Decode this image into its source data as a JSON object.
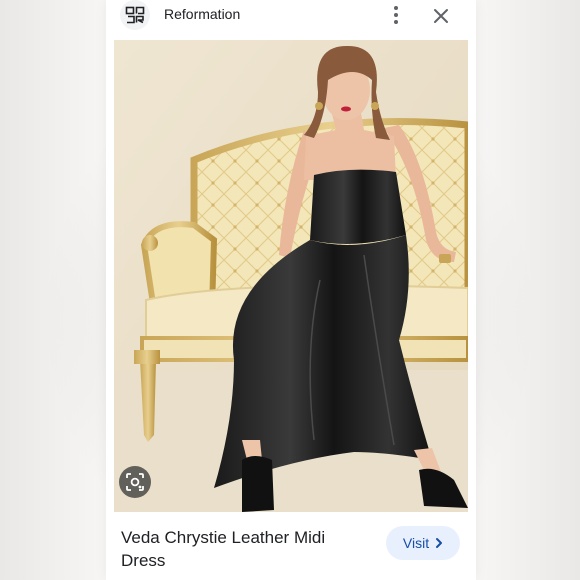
{
  "header": {
    "site_name": "Reformation",
    "logo_icon": "reformation-logo-icon",
    "menu_icon": "more-vert-icon",
    "close_icon": "close-icon"
  },
  "image": {
    "lens_icon": "lens-search-icon"
  },
  "product": {
    "title": "Veda Chrystie Leather Midi Dress",
    "visit_label": "Visit",
    "visit_icon": "chevron-right-icon"
  },
  "colors": {
    "accent": "#174ea6",
    "visit_bg": "#e8f0fe",
    "text": "#202124"
  }
}
